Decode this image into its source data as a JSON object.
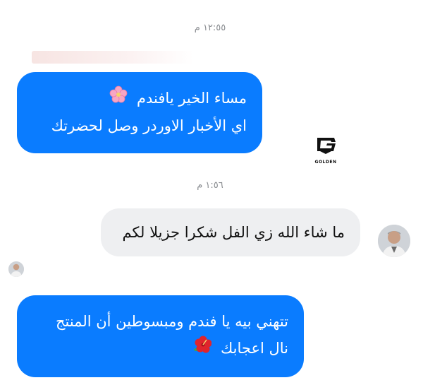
{
  "chat": {
    "time_1": "١٢:٥٥ م",
    "time_2": "١:٥٦ م",
    "messages": [
      {
        "line1": "مساء الخير يافندم",
        "line2": "اي الأخبار الاوردر وصل لحضرتك",
        "emoji": "cherry-blossom"
      },
      {
        "line1": "ما شاء الله زي الفل شكرا جزيلا لكم"
      },
      {
        "line1": "تتهني بيه يا فندم ومبسوطين أن المنتج",
        "line2": "نال اعجابك",
        "emoji": "hibiscus"
      }
    ]
  },
  "watermark": {
    "text": "GOLDEN"
  },
  "colors": {
    "outgoing": "#0a7cff",
    "incoming": "#eeeff1",
    "timestamp": "#8a8d91"
  }
}
